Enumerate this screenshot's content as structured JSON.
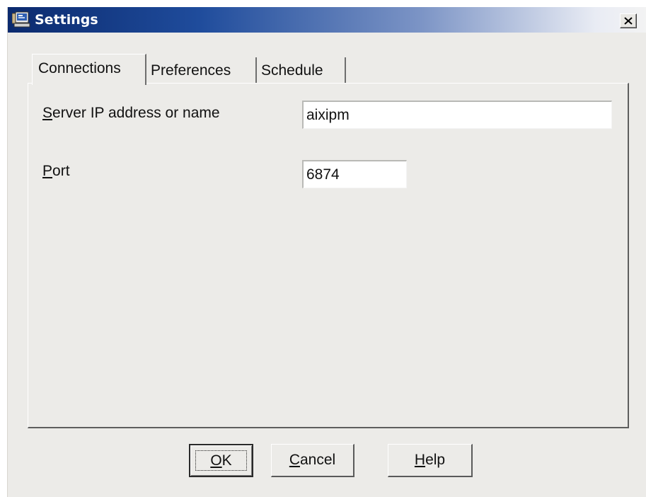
{
  "window": {
    "title": "Settings",
    "close_symbol": "×"
  },
  "tabs": [
    {
      "label": "Connections",
      "active": true
    },
    {
      "label": "Preferences",
      "active": false
    },
    {
      "label": "Schedule",
      "active": false
    }
  ],
  "connections": {
    "server_label_mnemonic": "S",
    "server_label_rest": "erver IP address or name",
    "server_value": "aixipm",
    "port_label_mnemonic": "P",
    "port_label_rest": "ort",
    "port_value": "6874"
  },
  "buttons": {
    "ok_mnemonic": "O",
    "ok_rest": "K",
    "cancel_mnemonic": "C",
    "cancel_rest": "ancel",
    "help_mnemonic": "H",
    "help_rest": "elp"
  },
  "icons": {
    "app": "settings-app-icon",
    "close": "close-icon"
  }
}
